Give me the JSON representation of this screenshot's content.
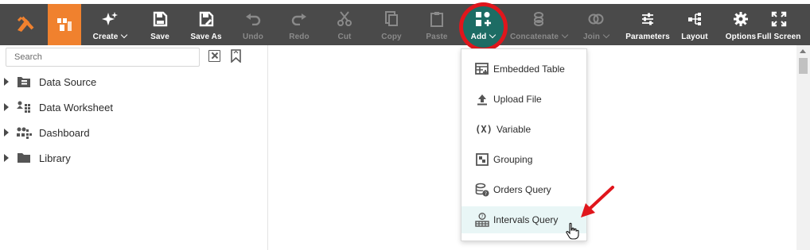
{
  "toolbar": {
    "create": "Create",
    "save": "Save",
    "save_as": "Save As",
    "undo": "Undo",
    "redo": "Redo",
    "cut": "Cut",
    "copy": "Copy",
    "paste": "Paste",
    "add": "Add",
    "concatenate": "Concatenate",
    "join": "Join",
    "parameters": "Parameters",
    "layout": "Layout",
    "options": "Options",
    "full_screen": "Full Screen"
  },
  "sidebar": {
    "search_placeholder": "Search",
    "items": [
      {
        "label": "Data Source",
        "icon": "data-source-icon"
      },
      {
        "label": "Data Worksheet",
        "icon": "worksheet-icon"
      },
      {
        "label": "Dashboard",
        "icon": "dashboard-icon"
      },
      {
        "label": "Library",
        "icon": "folder-icon"
      }
    ]
  },
  "add_menu": {
    "items": [
      {
        "label": "Embedded Table",
        "icon": "embedded-table-icon"
      },
      {
        "label": "Upload File",
        "icon": "upload-icon"
      },
      {
        "label": "Variable",
        "icon": "variable-icon"
      },
      {
        "label": "Grouping",
        "icon": "grouping-icon"
      },
      {
        "label": "Orders Query",
        "icon": "orders-query-icon"
      },
      {
        "label": "Intervals Query",
        "icon": "intervals-query-icon",
        "hovered": true
      }
    ]
  },
  "colors": {
    "toolbar_bg": "#4a4a4a",
    "brand_orange": "#f0812e",
    "add_active_bg": "#1d6c64",
    "highlight_circle": "#e0161c",
    "menu_hover": "#e9f6f6"
  }
}
